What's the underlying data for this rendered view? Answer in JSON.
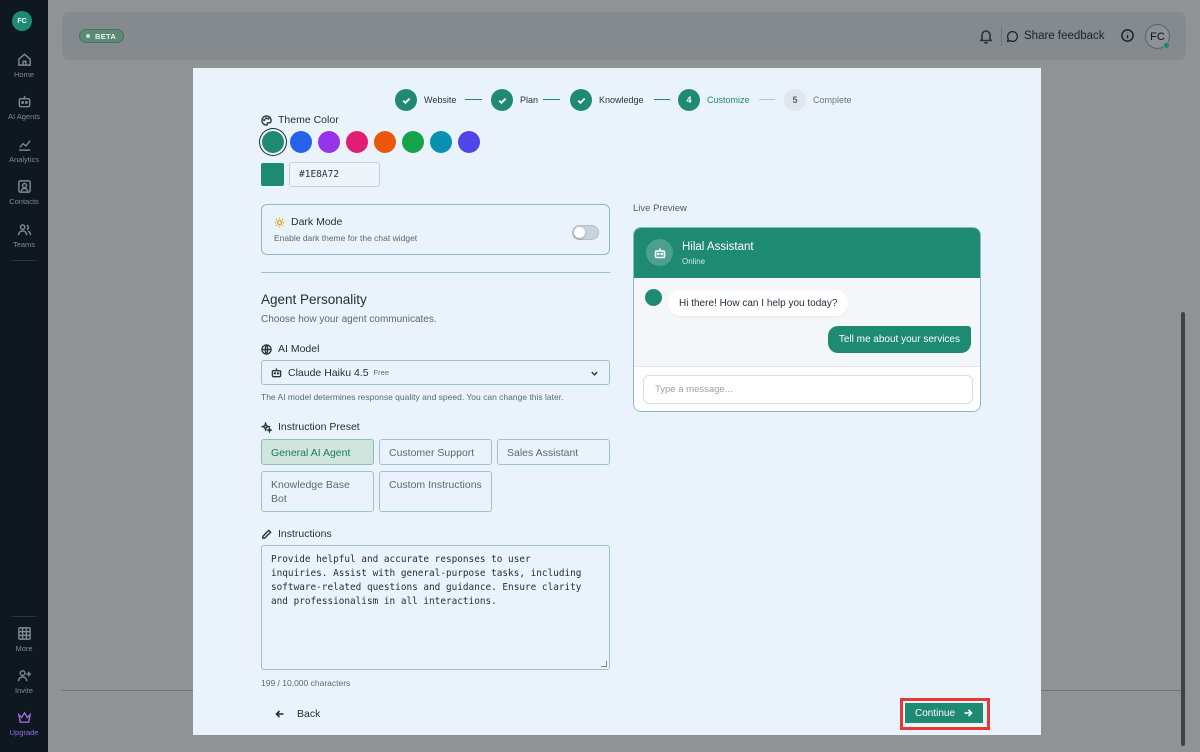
{
  "sidebar": {
    "avatar": "FC",
    "items": [
      {
        "label": "Home",
        "icon": "home-icon"
      },
      {
        "label": "AI Agents",
        "icon": "bot-icon"
      },
      {
        "label": "Analytics",
        "icon": "analytics-icon"
      },
      {
        "label": "Contacts",
        "icon": "contacts-icon"
      },
      {
        "label": "Teams",
        "icon": "teams-icon"
      },
      {
        "label": "More",
        "icon": "grid-icon"
      },
      {
        "label": "Invite",
        "icon": "user-plus-icon"
      },
      {
        "label": "Upgrade",
        "icon": "crown-icon"
      }
    ]
  },
  "topbar": {
    "badge": "BETA",
    "feedback_label": "Share feedback",
    "avatar": "FC"
  },
  "stepper": {
    "steps": [
      {
        "label": "Website",
        "state": "done",
        "num": ""
      },
      {
        "label": "Plan",
        "state": "done",
        "num": ""
      },
      {
        "label": "Knowledge",
        "state": "done",
        "num": ""
      },
      {
        "label": "Customize",
        "state": "active",
        "num": "4"
      },
      {
        "label": "Complete",
        "state": "pending",
        "num": "5"
      }
    ]
  },
  "theme": {
    "label": "Theme Color",
    "swatches": [
      "#1E8A72",
      "#2563EB",
      "#9333EA",
      "#E11D74",
      "#EA580C",
      "#16A34A",
      "#0891B2",
      "#4F46E5"
    ],
    "hex_value": "#1E8A72"
  },
  "dark_mode": {
    "title": "Dark Mode",
    "description": "Enable dark theme for the chat widget"
  },
  "personality": {
    "title": "Agent Personality",
    "subtitle": "Choose how your agent communicates."
  },
  "model": {
    "label": "AI Model",
    "value": "Claude Haiku 4.5",
    "tag": "Free",
    "help": "The AI model determines response quality and speed. You can change this later."
  },
  "preset": {
    "label": "Instruction Preset",
    "options": [
      "General AI Agent",
      "Customer Support",
      "Sales Assistant",
      "Knowledge Base Bot",
      "Custom Instructions"
    ],
    "selected": "General AI Agent"
  },
  "instructions": {
    "label": "Instructions",
    "text": "Provide helpful and accurate responses to user\ninquiries. Assist with general-purpose tasks, including\nsoftware-related questions and guidance. Ensure clarity\nand professionalism in all interactions.",
    "count": "199 / 10,000 characters"
  },
  "preview": {
    "title": "Live Preview",
    "bot_name": "Hilal Assistant",
    "status": "Online",
    "bot_message": "Hi there! How can I help you today?",
    "user_message": "Tell me about your services",
    "placeholder": "Type a message..."
  },
  "footer": {
    "back_label": "Back",
    "continue_label": "Continue"
  },
  "colors": {
    "accent": "#1E8A72",
    "highlight_border": "#E53935"
  }
}
